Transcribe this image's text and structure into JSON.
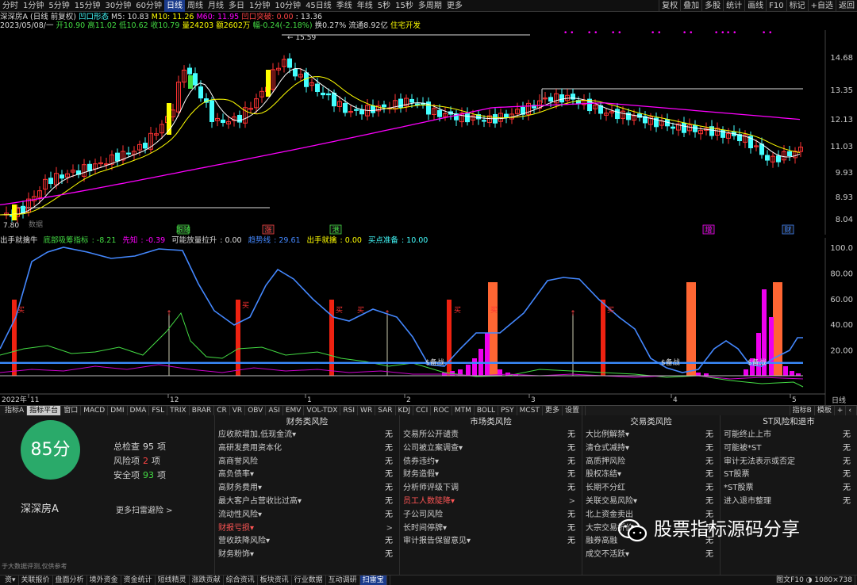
{
  "toolbar": {
    "periods": [
      "分时",
      "1分钟",
      "5分钟",
      "15分钟",
      "30分钟",
      "60分钟",
      "日线",
      "周线",
      "月线",
      "多日",
      "1分钟",
      "10分钟",
      "45日线",
      "季线",
      "年线",
      "5秒",
      "15秒",
      "多周期",
      "更多"
    ],
    "selected": "日线",
    "right_buttons": [
      "复权",
      "叠加",
      "多股",
      "统计",
      "画线",
      "F10",
      "标记",
      "+自选",
      "返回"
    ]
  },
  "info": {
    "stock": "深深房A",
    "mode": "(日线 前复权)",
    "pattern_label": "凹口形态",
    "ma5": "M5: 10.83",
    "ma10": "M10: 11.26",
    "ma60": "M60: 11.95",
    "notch": "凹口突破: 0.00",
    "last": ": 13.36",
    "date": "2023/05/08/一",
    "open": "开10.90",
    "high": "高11.02",
    "low": "低10.62",
    "close": "收10.79",
    "volume": "量24203",
    "amount": "额2602万",
    "change": "幅-0.24(-2.18%)",
    "turnover": "换0.27%",
    "float_mv": "流通8.92亿",
    "sector": "住宅开发"
  },
  "kline": {
    "price_labels": [
      "14.68",
      "13.35",
      "12.13",
      "11.03",
      "9.93",
      "8.93",
      "8.04"
    ],
    "max_marker": "15.59",
    "min_marker": "7.80",
    "stamp_text": "数据",
    "event_tags": [
      {
        "text": "跟随",
        "color": "#4d4"
      },
      {
        "text": "涨",
        "color": "#f44"
      },
      {
        "text": "港",
        "color": "#4d4"
      },
      {
        "text": "增",
        "color": "#f0f"
      },
      {
        "text": "财",
        "color": "#48f"
      }
    ]
  },
  "indicator": {
    "title": "出手就擒牛",
    "items": [
      {
        "label": "底部吸筹指标",
        "value": "-8.21",
        "color": "#4d4"
      },
      {
        "label": "先知",
        "value": "-0.39",
        "color": "#f0f"
      },
      {
        "label": "可能放量拉升",
        "value": "0.00",
        "color": "#ddd"
      },
      {
        "label": "趋势线",
        "value": "29.61",
        "color": "#48f"
      },
      {
        "label": "出手就擒",
        "value": "0.00",
        "color": "#ff0"
      },
      {
        "label": "买点准备",
        "value": "10.00",
        "color": "#4ff"
      }
    ],
    "y_labels": [
      "100.0",
      "80.00",
      "60.00",
      "40.00",
      "20.00"
    ],
    "buy_label": "买",
    "ready_label": "$备战",
    "timeline": {
      "year": "2022年",
      "months": [
        "11",
        "12",
        "1",
        "2",
        "3",
        "4",
        "5"
      ],
      "period": "日线"
    }
  },
  "tabs": {
    "items": [
      "指标A",
      "指标平台",
      "窗口",
      "MACD",
      "DMI",
      "DMA",
      "FSL",
      "TRIX",
      "BRAR",
      "CR",
      "VR",
      "OBV",
      "ASI",
      "EMV",
      "VOL-TDX",
      "RSI",
      "WR",
      "SAR",
      "KDJ",
      "CCI",
      "ROC",
      "MTM",
      "BOLL",
      "PSY",
      "MCST",
      "更多",
      "设置"
    ],
    "selected": "指标平台",
    "right": [
      "指标B",
      "模板",
      "+",
      "‹"
    ]
  },
  "scan": {
    "score": "85分",
    "stock_name": "深深房A",
    "stats": [
      {
        "label": "总检查",
        "value": "95",
        "unit": "项",
        "color": "#ddd"
      },
      {
        "label": "风险项",
        "value": "2",
        "unit": "项",
        "color": "#f44"
      },
      {
        "label": "安全项",
        "value": "93",
        "unit": "项",
        "color": "#4d4"
      }
    ],
    "more_link": "更多扫雷避险 >",
    "disclaimer": "于大数据评测,仅供参考",
    "columns": [
      {
        "title": "财务类风险",
        "rows": [
          {
            "label": "应收款增加,低现金流▾",
            "status": "无"
          },
          {
            "label": "高研发费用资本化",
            "status": "无"
          },
          {
            "label": "高商誉风险",
            "status": "无"
          },
          {
            "label": "高负债率▾",
            "status": "无"
          },
          {
            "label": "高财务费用▾",
            "status": "无"
          },
          {
            "label": "最大客户占营收比过高▾",
            "status": "无"
          },
          {
            "label": "流动性风险▾",
            "status": "无"
          },
          {
            "label": "财报亏损▾",
            "status": ">",
            "warn": true
          },
          {
            "label": "营收跌降风险▾",
            "status": "无"
          },
          {
            "label": "财务粉饰▾",
            "status": "无"
          }
        ]
      },
      {
        "title": "市场类风险",
        "rows": [
          {
            "label": "交易所公开谴责",
            "status": "无"
          },
          {
            "label": "公司被立案调查▾",
            "status": "无"
          },
          {
            "label": "债券违约▾",
            "status": "无"
          },
          {
            "label": "财务造假▾",
            "status": "无"
          },
          {
            "label": "分析师评级下调",
            "status": "无"
          },
          {
            "label": "员工人数陡降▾",
            "status": ">",
            "warn": true
          },
          {
            "label": "子公司风险",
            "status": "无"
          },
          {
            "label": "长时间停牌▾",
            "status": "无"
          },
          {
            "label": "审计报告保留意见▾",
            "status": "无"
          }
        ]
      },
      {
        "title": "交易类风险",
        "rows": [
          {
            "label": "大比例解禁▾",
            "status": "无"
          },
          {
            "label": "清仓式减持▾",
            "status": "无"
          },
          {
            "label": "高质押风险",
            "status": "无"
          },
          {
            "label": "股权冻结▾",
            "status": "无"
          },
          {
            "label": "长期不分红",
            "status": "无"
          },
          {
            "label": "关联交易风险▾",
            "status": "无"
          },
          {
            "label": "北上资金卖出",
            "status": "无"
          },
          {
            "label": "大宗交易折价",
            "status": "无"
          },
          {
            "label": "融券高融",
            "status": "无"
          },
          {
            "label": "成交不活跃▾",
            "status": "无"
          }
        ]
      },
      {
        "title": "ST风险和退市",
        "rows": [
          {
            "label": "可能终止上市",
            "status": "无"
          },
          {
            "label": "可能被*ST",
            "status": "无"
          },
          {
            "label": "审计无法表示或否定",
            "status": "无"
          },
          {
            "label": "ST股票",
            "status": "无"
          },
          {
            "label": "*ST股票",
            "status": "无"
          },
          {
            "label": "进入退市整理",
            "status": "无"
          }
        ]
      }
    ]
  },
  "watermark": "股票指标源码分享",
  "bottom": {
    "items": [
      "资▾",
      "关联报价",
      "盘面分析",
      "境外资金",
      "资金统计",
      "短线精灵",
      "涨跌贡献",
      "综合资讯",
      "板块资讯",
      "行业数据",
      "互动调研",
      "扫雷宝"
    ],
    "selected": "扫雷宝",
    "right": "图文F10 ◑ 1080×738"
  },
  "colors": {
    "up": "#f33",
    "down": "#4ff",
    "ma5": "#fff",
    "ma10": "#ff0",
    "ma60": "#f0f",
    "trend": "#48f",
    "score": "#2aaa6a"
  }
}
